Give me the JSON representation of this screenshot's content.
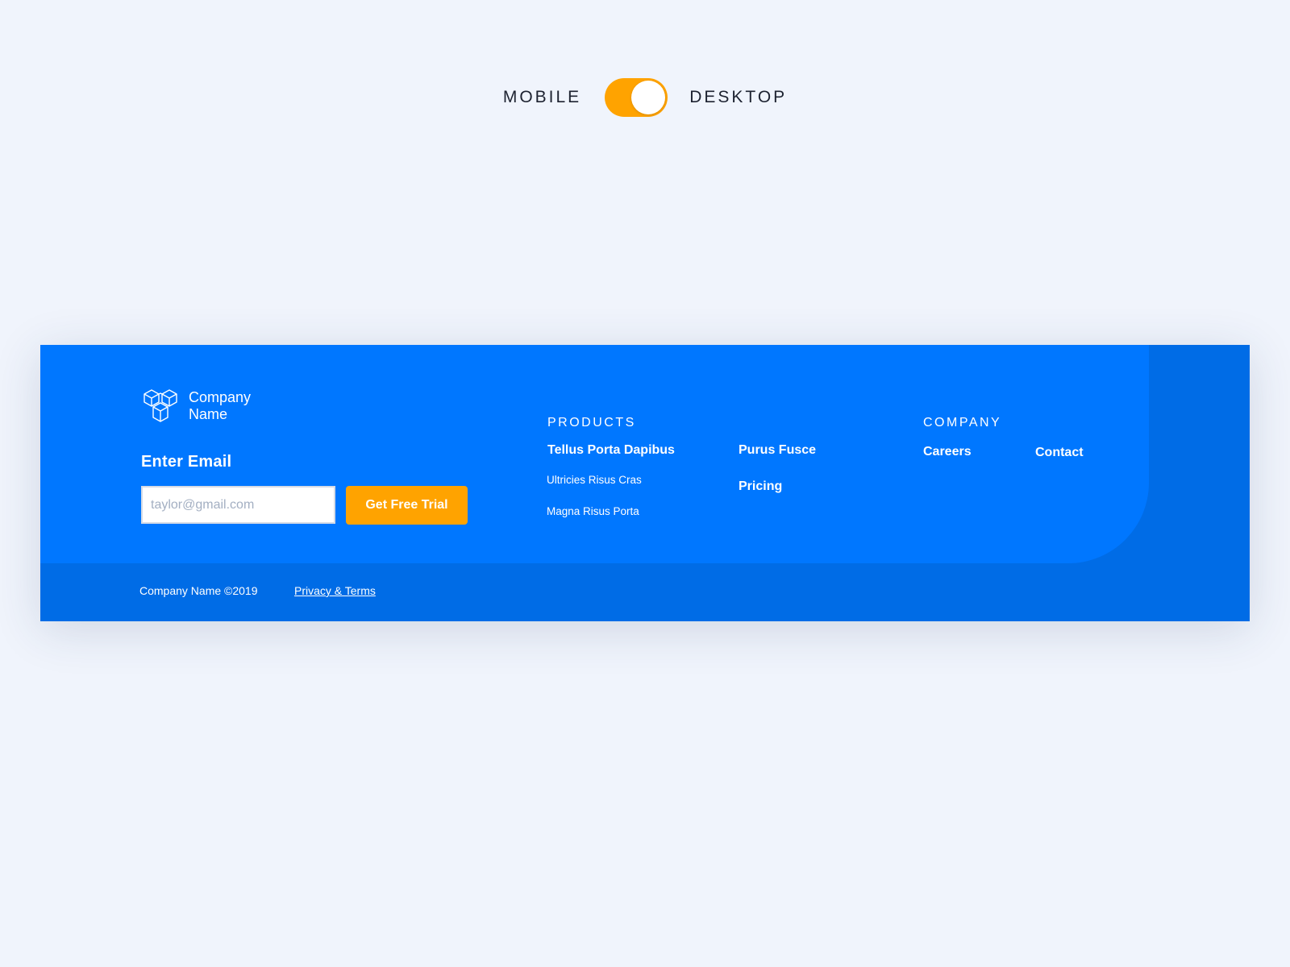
{
  "view_toggle": {
    "left_label": "MOBILE",
    "right_label": "DESKTOP",
    "selected": "DESKTOP",
    "accent_color": "#ffa300"
  },
  "footer": {
    "brand": {
      "logo_icon": "hexagon-cubes-icon",
      "name_line1": "Company",
      "name_line2": "Name"
    },
    "signup": {
      "label": "Enter Email",
      "placeholder": "taylor@gmail.com",
      "button_label": "Get Free Trial"
    },
    "products": {
      "heading": "PRODUCTS",
      "links": [
        "Tellus Porta Dapibus",
        "Ultricies Risus Cras",
        "Magna Risus Porta",
        "Purus Fusce",
        "Pricing"
      ]
    },
    "company": {
      "heading": "COMPANY",
      "links": [
        "Careers",
        "Contact"
      ]
    },
    "bottom": {
      "copyright": "Company Name ©2019",
      "legal_link": "Privacy & Terms"
    },
    "colors": {
      "primary": "#0077ff",
      "primary_dark": "#006ce6",
      "button": "#ffa300"
    }
  }
}
